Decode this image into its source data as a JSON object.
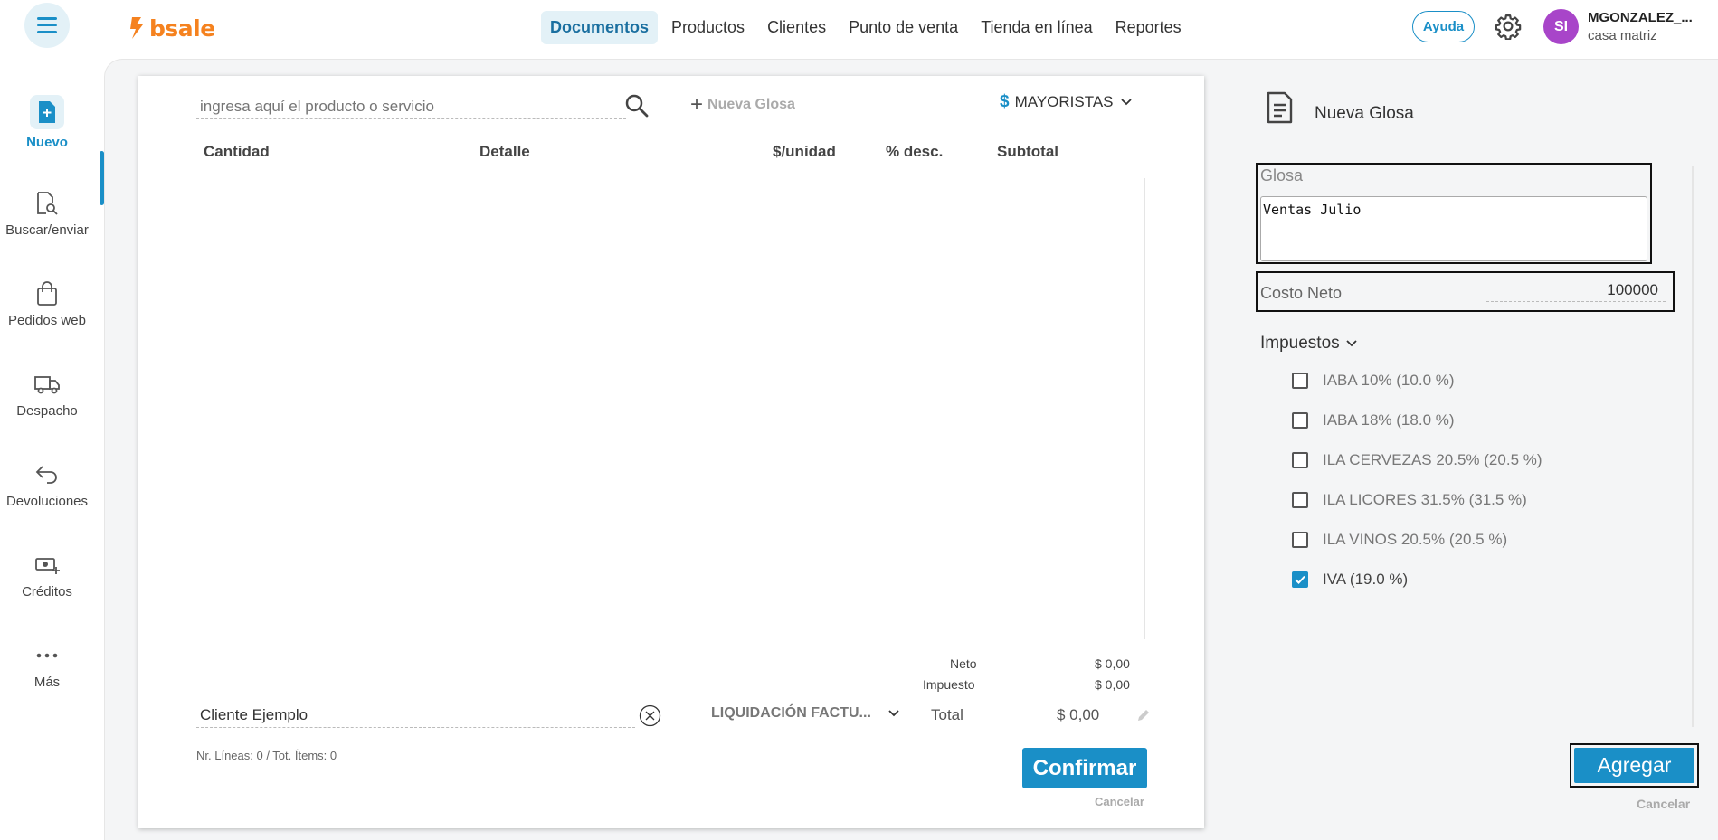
{
  "app": {
    "logo_text": "bsale",
    "brand_color": "#f5821f",
    "accent_color": "#1a8fc7"
  },
  "nav": [
    {
      "label": "Documentos",
      "active": true
    },
    {
      "label": "Productos"
    },
    {
      "label": "Clientes"
    },
    {
      "label": "Punto de venta"
    },
    {
      "label": "Tienda en línea"
    },
    {
      "label": "Reportes"
    }
  ],
  "header": {
    "help_label": "Ayuda",
    "avatar_initials": "SI",
    "user_name": "MGONZALEZ_...",
    "user_branch": "casa matriz"
  },
  "sidebar": {
    "items": [
      {
        "label": "Nuevo",
        "icon": "new-document-icon",
        "active": true
      },
      {
        "label": "Buscar/enviar",
        "icon": "search-document-icon"
      },
      {
        "label": "Pedidos web",
        "icon": "shopping-bag-icon"
      },
      {
        "label": "Despacho",
        "icon": "truck-icon"
      },
      {
        "label": "Devoluciones",
        "icon": "return-arrow-icon"
      },
      {
        "label": "Créditos",
        "icon": "money-plus-icon"
      },
      {
        "label": "Más",
        "icon": "more-dots-icon"
      }
    ]
  },
  "document": {
    "search_placeholder": "ingresa aquí el producto o servicio",
    "nueva_glosa_label": "Nueva Glosa",
    "price_list_symbol": "$",
    "price_list_label": "MAYORISTAS",
    "columns": [
      "Cantidad",
      "Detalle",
      "$/unidad",
      "% desc.",
      "Subtotal"
    ],
    "totals": {
      "neto_label": "Neto",
      "neto_value": "$ 0,00",
      "impuesto_label": "Impuesto",
      "impuesto_value": "$ 0,00",
      "total_label": "Total",
      "total_value": "$ 0,00"
    },
    "client_value": "Cliente Ejemplo",
    "doc_type_label": "LIQUIDACIÓN FACTU...",
    "lines_info": "Nr. Líneas: 0 / Tot. Ítems: 0",
    "confirm_label": "Confirmar",
    "cancel_label": "Cancelar"
  },
  "panel": {
    "title": "Nueva Glosa",
    "glosa_label": "Glosa",
    "glosa_value": "Ventas Julio",
    "costo_label": "Costo Neto",
    "costo_value": "100000",
    "impuestos_label": "Impuestos",
    "taxes": [
      {
        "label": "IABA 10% (10.0 %)",
        "checked": false
      },
      {
        "label": "IABA 18% (18.0 %)",
        "checked": false
      },
      {
        "label": "ILA CERVEZAS 20.5% (20.5 %)",
        "checked": false
      },
      {
        "label": "ILA LICORES 31.5% (31.5 %)",
        "checked": false
      },
      {
        "label": "ILA VINOS 20.5% (20.5 %)",
        "checked": false
      },
      {
        "label": "IVA (19.0 %)",
        "checked": true
      }
    ],
    "agregar_label": "Agregar",
    "cancel_label": "Cancelar"
  }
}
